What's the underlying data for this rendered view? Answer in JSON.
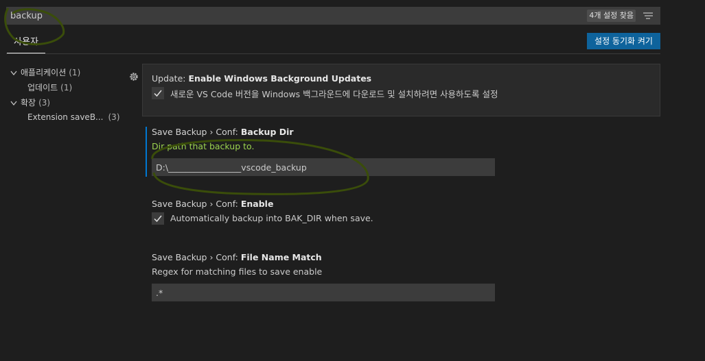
{
  "search": {
    "value": "backup",
    "result_count": "4개 설정 찾음"
  },
  "tabs": {
    "user": "사용자"
  },
  "sync_button": {
    "label": "설정 동기화 켜기"
  },
  "tree": [
    {
      "label": "애플리케이션",
      "count": "(1)"
    },
    {
      "label": "업데이트",
      "count": "(1)"
    },
    {
      "label": "확장",
      "count": "(3)"
    },
    {
      "label": "Extension saveB...",
      "count": "(3)"
    }
  ],
  "settings": [
    {
      "category": "Update: ",
      "name": "Enable Windows Background Updates",
      "description": "새로운 VS Code 버전을 Windows 백그라운드에 다운로드 및 설치하려면 사용하도록 설정",
      "checked": true
    },
    {
      "category": "Save Backup › Conf: ",
      "name": "Backup Dir",
      "description": "Dir path that backup to.",
      "value": "D:\\_________________vscode_backup"
    },
    {
      "category": "Save Backup › Conf: ",
      "name": "Enable",
      "description": "Automatically backup into BAK_DIR when save.",
      "checked": true
    },
    {
      "category": "Save Backup › Conf: ",
      "name": "File Name Match",
      "description": "Regex for matching files to save enable",
      "value": ".*"
    }
  ],
  "colors": {
    "accent": "#0e639c",
    "focus": "#0078d4",
    "annotation": "#3a4d0a"
  },
  "icons": {
    "filter": "filter-list-icon",
    "gear": "gear-icon",
    "check": "check-icon",
    "chevron": "chevron-down-icon"
  }
}
